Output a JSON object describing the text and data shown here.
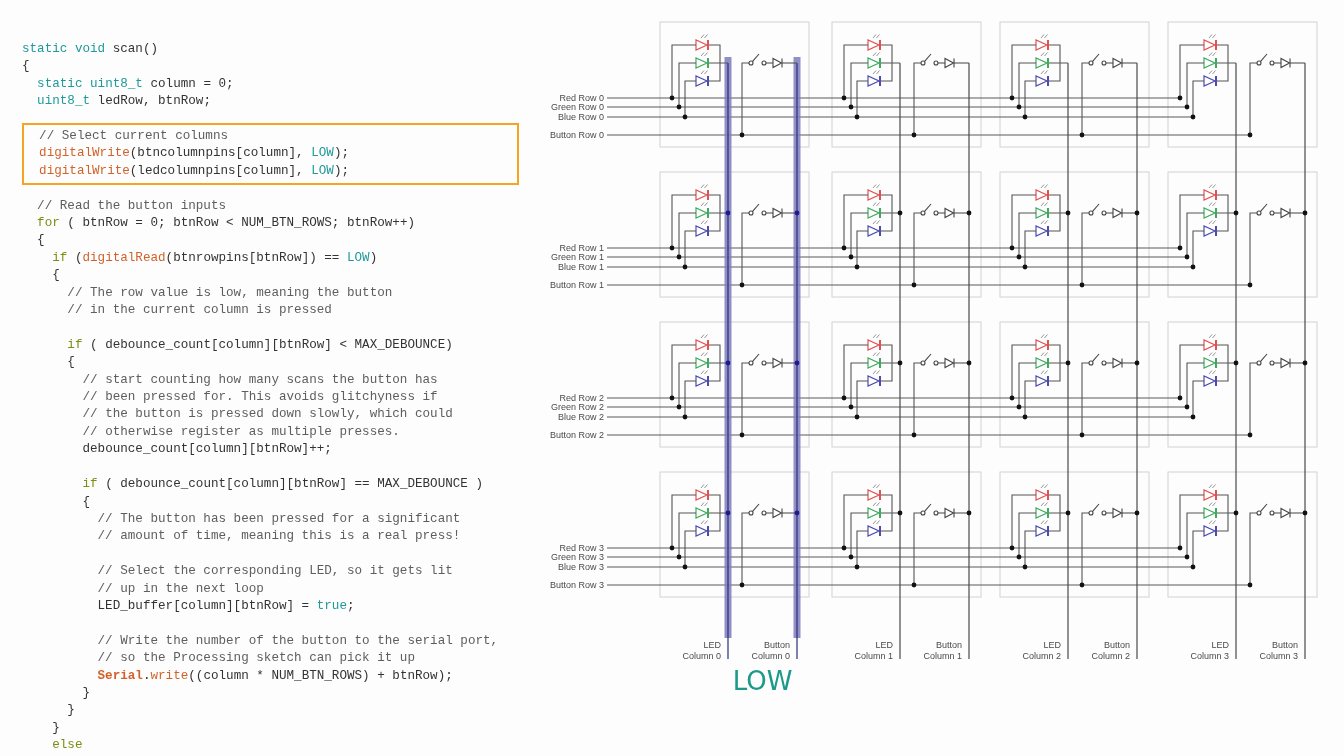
{
  "code": {
    "blocks": [
      {
        "highlighted": false,
        "lines": [
          {
            "tokens": [
              {
                "kind": "keyword",
                "text": "static void"
              },
              {
                "kind": "plain",
                "text": " scan()"
              }
            ]
          },
          {
            "tokens": [
              {
                "kind": "plain",
                "text": "{"
              }
            ],
            "children": [
              {
                "highlighted": false,
                "lines": [
                  {
                    "tokens": [
                      {
                        "kind": "keyword",
                        "text": "static uint8_t"
                      },
                      {
                        "kind": "plain",
                        "text": " column = 0;"
                      }
                    ]
                  },
                  {
                    "tokens": [
                      {
                        "kind": "keyword",
                        "text": "uint8_t"
                      },
                      {
                        "kind": "plain",
                        "text": " ledRow, btnRow;"
                      }
                    ]
                  }
                ]
              },
              {
                "highlighted": true,
                "lines": [
                  {
                    "tokens": [
                      {
                        "kind": "comment",
                        "text": "// Select current columns"
                      }
                    ]
                  },
                  {
                    "tokens": [
                      {
                        "kind": "function",
                        "text": "digitalWrite"
                      },
                      {
                        "kind": "plain",
                        "text": "(btncolumnpins[column], "
                      },
                      {
                        "kind": "keyword",
                        "text": "LOW"
                      },
                      {
                        "kind": "plain",
                        "text": ");"
                      }
                    ]
                  },
                  {
                    "tokens": [
                      {
                        "kind": "function",
                        "text": "digitalWrite"
                      },
                      {
                        "kind": "plain",
                        "text": "(ledcolumnpins[column], "
                      },
                      {
                        "kind": "keyword",
                        "text": "LOW"
                      },
                      {
                        "kind": "plain",
                        "text": ");"
                      }
                    ]
                  }
                ]
              },
              {
                "highlighted": false,
                "lines": [
                  {
                    "tokens": [
                      {
                        "kind": "comment",
                        "text": "// Read the button inputs"
                      }
                    ]
                  },
                  {
                    "tokens": [
                      {
                        "kind": "control",
                        "text": "for"
                      },
                      {
                        "kind": "plain",
                        "text": " ( btnRow = 0; btnRow < NUM_BTN_ROWS; btnRow++)"
                      }
                    ]
                  },
                  {
                    "tokens": [
                      {
                        "kind": "plain",
                        "text": "{"
                      }
                    ],
                    "children": [
                      {
                        "highlighted": false,
                        "lines": [
                          {
                            "tokens": [
                              {
                                "kind": "control",
                                "text": "if"
                              },
                              {
                                "kind": "plain",
                                "text": " ("
                              },
                              {
                                "kind": "function",
                                "text": "digitalRead"
                              },
                              {
                                "kind": "plain",
                                "text": "(btnrowpins[btnRow]) == "
                              },
                              {
                                "kind": "keyword",
                                "text": "LOW"
                              },
                              {
                                "kind": "plain",
                                "text": ")"
                              }
                            ]
                          },
                          {
                            "tokens": [
                              {
                                "kind": "plain",
                                "text": "{"
                              }
                            ],
                            "children": [
                              {
                                "highlighted": false,
                                "lines": [
                                  {
                                    "tokens": [
                                      {
                                        "kind": "comment",
                                        "text": "// The row value is low, meaning the button"
                                      }
                                    ]
                                  },
                                  {
                                    "tokens": [
                                      {
                                        "kind": "comment",
                                        "text": "// in the current column is pressed"
                                      }
                                    ]
                                  }
                                ]
                              },
                              {
                                "highlighted": false,
                                "lines": [
                                  {
                                    "tokens": [
                                      {
                                        "kind": "control",
                                        "text": "if"
                                      },
                                      {
                                        "kind": "plain",
                                        "text": " ( debounce_count[column][btnRow] < MAX_DEBOUNCE)"
                                      }
                                    ]
                                  },
                                  {
                                    "tokens": [
                                      {
                                        "kind": "plain",
                                        "text": "{"
                                      }
                                    ],
                                    "children": [
                                      {
                                        "highlighted": false,
                                        "lines": [
                                          {
                                            "tokens": [
                                              {
                                                "kind": "comment",
                                                "text": "// start counting how many scans the button has"
                                              }
                                            ]
                                          },
                                          {
                                            "tokens": [
                                              {
                                                "kind": "comment",
                                                "text": "// been pressed for. This avoids glitchyness if"
                                              }
                                            ]
                                          },
                                          {
                                            "tokens": [
                                              {
                                                "kind": "comment",
                                                "text": "// the button is pressed down slowly, which could"
                                              }
                                            ]
                                          },
                                          {
                                            "tokens": [
                                              {
                                                "kind": "comment",
                                                "text": "// otherwise register as multiple presses."
                                              }
                                            ]
                                          },
                                          {
                                            "tokens": [
                                              {
                                                "kind": "plain",
                                                "text": "debounce_count[column][btnRow]++;"
                                              }
                                            ]
                                          }
                                        ]
                                      },
                                      {
                                        "highlighted": false,
                                        "lines": [
                                          {
                                            "tokens": [
                                              {
                                                "kind": "control",
                                                "text": "if"
                                              },
                                              {
                                                "kind": "plain",
                                                "text": " ( debounce_count[column][btnRow] == MAX_DEBOUNCE )"
                                              }
                                            ]
                                          },
                                          {
                                            "tokens": [
                                              {
                                                "kind": "plain",
                                                "text": "{"
                                              }
                                            ],
                                            "children": [
                                              {
                                                "highlighted": false,
                                                "lines": [
                                                  {
                                                    "tokens": [
                                                      {
                                                        "kind": "comment",
                                                        "text": "// The button has been pressed for a significant"
                                                      }
                                                    ]
                                                  },
                                                  {
                                                    "tokens": [
                                                      {
                                                        "kind": "comment",
                                                        "text": "// amount of time, meaning this is a real press!"
                                                      }
                                                    ]
                                                  }
                                                ]
                                              },
                                              {
                                                "highlighted": false,
                                                "lines": [
                                                  {
                                                    "tokens": [
                                                      {
                                                        "kind": "comment",
                                                        "text": "// Select the corresponding LED, so it gets lit"
                                                      }
                                                    ]
                                                  },
                                                  {
                                                    "tokens": [
                                                      {
                                                        "kind": "comment",
                                                        "text": "// up in the next loop"
                                                      }
                                                    ]
                                                  },
                                                  {
                                                    "tokens": [
                                                      {
                                                        "kind": "plain",
                                                        "text": "LED_buffer[column][btnRow] = "
                                                      },
                                                      {
                                                        "kind": "keyword",
                                                        "text": "true"
                                                      },
                                                      {
                                                        "kind": "plain",
                                                        "text": ";"
                                                      }
                                                    ]
                                                  }
                                                ]
                                              },
                                              {
                                                "highlighted": false,
                                                "lines": [
                                                  {
                                                    "tokens": [
                                                      {
                                                        "kind": "comment",
                                                        "text": "// Write the number of the button to the serial port,"
                                                      }
                                                    ]
                                                  },
                                                  {
                                                    "tokens": [
                                                      {
                                                        "kind": "comment",
                                                        "text": "// so the Processing sketch can pick it up"
                                                      }
                                                    ]
                                                  },
                                                  {
                                                    "tokens": [
                                                      {
                                                        "kind": "object",
                                                        "text": "Serial"
                                                      },
                                                      {
                                                        "kind": "plain",
                                                        "text": "."
                                                      },
                                                      {
                                                        "kind": "function",
                                                        "text": "write"
                                                      },
                                                      {
                                                        "kind": "plain",
                                                        "text": "((column * NUM_BTN_ROWS) + btnRow);"
                                                      }
                                                    ]
                                                  }
                                                ]
                                              }
                                            ]
                                          },
                                          {
                                            "tokens": [
                                              {
                                                "kind": "plain",
                                                "text": "}"
                                              }
                                            ]
                                          }
                                        ]
                                      }
                                    ]
                                  },
                                  {
                                    "tokens": [
                                      {
                                        "kind": "plain",
                                        "text": "}"
                                      }
                                    ]
                                  }
                                ]
                              }
                            ]
                          },
                          {
                            "tokens": [
                              {
                                "kind": "plain",
                                "text": "}"
                              }
                            ]
                          },
                          {
                            "tokens": [
                              {
                                "kind": "control",
                                "text": "else"
                              }
                            ]
                          }
                        ]
                      }
                    ]
                  }
                ]
              }
            ]
          }
        ]
      }
    ]
  },
  "diagram": {
    "rows": [
      {
        "lines": [
          {
            "kind": "led",
            "label": "Red Row 0",
            "color": "#e05252"
          },
          {
            "kind": "led",
            "label": "Green Row 0",
            "color": "#3faa5e"
          },
          {
            "kind": "led",
            "label": "Blue Row 0",
            "color": "#4c4cae"
          },
          {
            "kind": "button",
            "label": "Button Row 0"
          }
        ]
      },
      {
        "lines": [
          {
            "kind": "led",
            "label": "Red Row 1",
            "color": "#e05252"
          },
          {
            "kind": "led",
            "label": "Green Row 1",
            "color": "#3faa5e"
          },
          {
            "kind": "led",
            "label": "Blue Row 1",
            "color": "#4c4cae"
          },
          {
            "kind": "button",
            "label": "Button Row 1"
          }
        ]
      },
      {
        "lines": [
          {
            "kind": "led",
            "label": "Red Row 2",
            "color": "#e05252"
          },
          {
            "kind": "led",
            "label": "Green Row 2",
            "color": "#3faa5e"
          },
          {
            "kind": "led",
            "label": "Blue Row 2",
            "color": "#4c4cae"
          },
          {
            "kind": "button",
            "label": "Button Row 2"
          }
        ]
      },
      {
        "lines": [
          {
            "kind": "led",
            "label": "Red Row 3",
            "color": "#e05252"
          },
          {
            "kind": "led",
            "label": "Green Row 3",
            "color": "#3faa5e"
          },
          {
            "kind": "led",
            "label": "Blue Row 3",
            "color": "#4c4cae"
          },
          {
            "kind": "button",
            "label": "Button Row 3"
          }
        ]
      }
    ],
    "columns": [
      {
        "led_label": "LED Column 0",
        "button_label": "Button Column 0",
        "selected": true
      },
      {
        "led_label": "LED Column 1",
        "button_label": "Button Column 1",
        "selected": false
      },
      {
        "led_label": "LED Column 2",
        "button_label": "Button Column 2",
        "selected": false
      },
      {
        "led_label": "LED Column 3",
        "button_label": "Button Column 3",
        "selected": false
      }
    ],
    "state_label": "LOW"
  }
}
